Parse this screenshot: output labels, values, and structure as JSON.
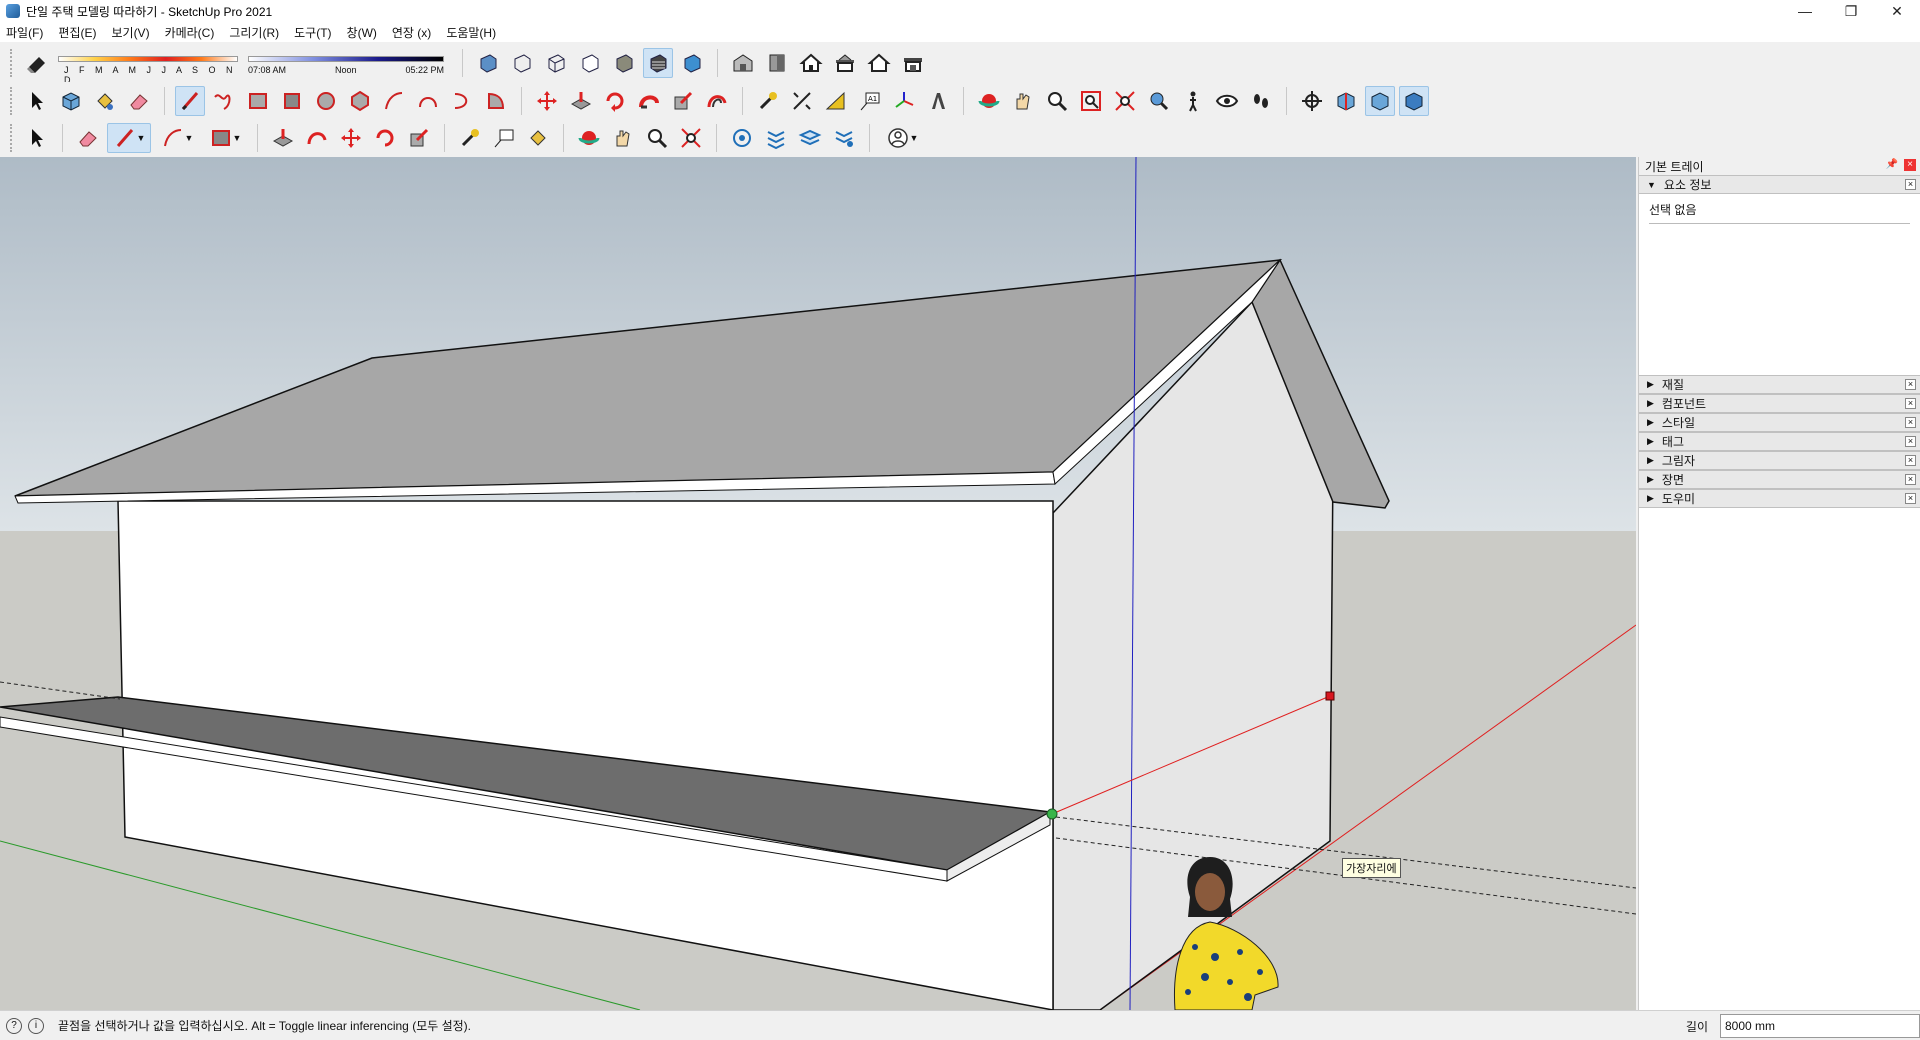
{
  "window": {
    "title": "단일 주택 모델링 따라하기 - SketchUp Pro 2021",
    "minimize_glyph": "—",
    "restore_glyph": "❐",
    "close_glyph": "✕"
  },
  "menu": [
    "파일(F)",
    "편집(E)",
    "보기(V)",
    "카메라(C)",
    "그리기(R)",
    "도구(T)",
    "창(W)",
    "연장 (x)",
    "도움말(H)"
  ],
  "shadows": {
    "months": "J F M A M J J A S O N D",
    "time_start": "07:08 AM",
    "time_mid": "Noon",
    "time_end": "05:22 PM"
  },
  "tooltip": "가장자리에",
  "tray": {
    "title": "기본 트레이",
    "entity_panel": "요소 정보",
    "entity_value": "선택 없음",
    "panels": [
      "재질",
      "컴포넌트",
      "스타일",
      "태그",
      "그림자",
      "장면",
      "도우미"
    ]
  },
  "status": {
    "message": "끝점을 선택하거나 값을 입력하십시오. Alt = Toggle linear inferencing (모두 설정).",
    "vcb_label": "길이",
    "vcb_value": "8000 mm"
  },
  "colors": {
    "sky": "#c9d3da",
    "ground": "#cbcbc6",
    "roof": "#a7a7a7",
    "wall_front": "#ffffff",
    "wall_side": "#e6e6e6",
    "canopy": "#6d6d6d",
    "red_axis": "#e02020",
    "green_axis": "#2a9a2a",
    "blue_axis": "#2020c0"
  }
}
